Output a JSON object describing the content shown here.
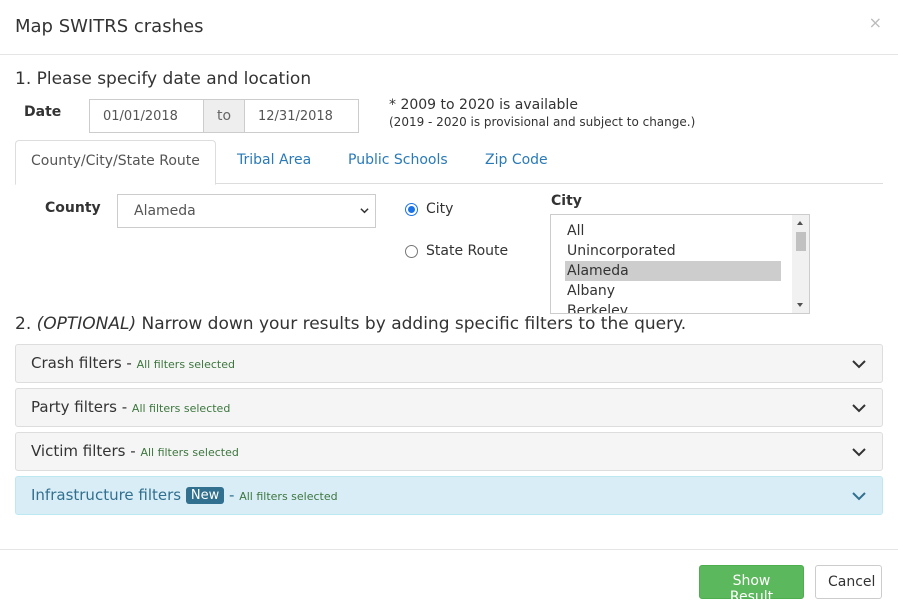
{
  "modal": {
    "title": "Map SWITRS crashes",
    "close": "×"
  },
  "step1": {
    "title": "1. Please specify date and location"
  },
  "date": {
    "label": "Date",
    "start": "01/01/2018",
    "to": "to",
    "end": "12/31/2018",
    "note": "* 2009 to 2020 is available",
    "note_sub": "(2019 - 2020 is provisional and subject to change.)"
  },
  "tabs": [
    "County/City/State Route",
    "Tribal Area",
    "Public Schools",
    "Zip Code"
  ],
  "location": {
    "county_label": "County",
    "county_value": "Alameda",
    "radio_city": "City",
    "radio_state_route": "State Route",
    "city_label": "City",
    "city_options": [
      "All",
      "Unincorporated",
      "Alameda",
      "Albany",
      "Berkeley"
    ],
    "city_selected": "Alameda"
  },
  "step2": {
    "prefix": "2. ",
    "optional": "(OPTIONAL)",
    "text": " Narrow down your results by adding specific filters to the query."
  },
  "filters": [
    {
      "title": "Crash filters",
      "status": "All filters selected"
    },
    {
      "title": "Party filters",
      "status": "All filters selected"
    },
    {
      "title": "Victim filters",
      "status": "All filters selected"
    },
    {
      "title": "Infrastructure filters",
      "badge": "New",
      "status": "All filters selected"
    }
  ],
  "separator": " - ",
  "buttons": {
    "show_result": "Show Result",
    "cancel": "Cancel"
  },
  "colors": {
    "link": "#2a7ab8",
    "success": "#5cb85c",
    "info_bg": "#d9edf7",
    "info_text": "#31708f",
    "status_green": "#3c763d"
  }
}
